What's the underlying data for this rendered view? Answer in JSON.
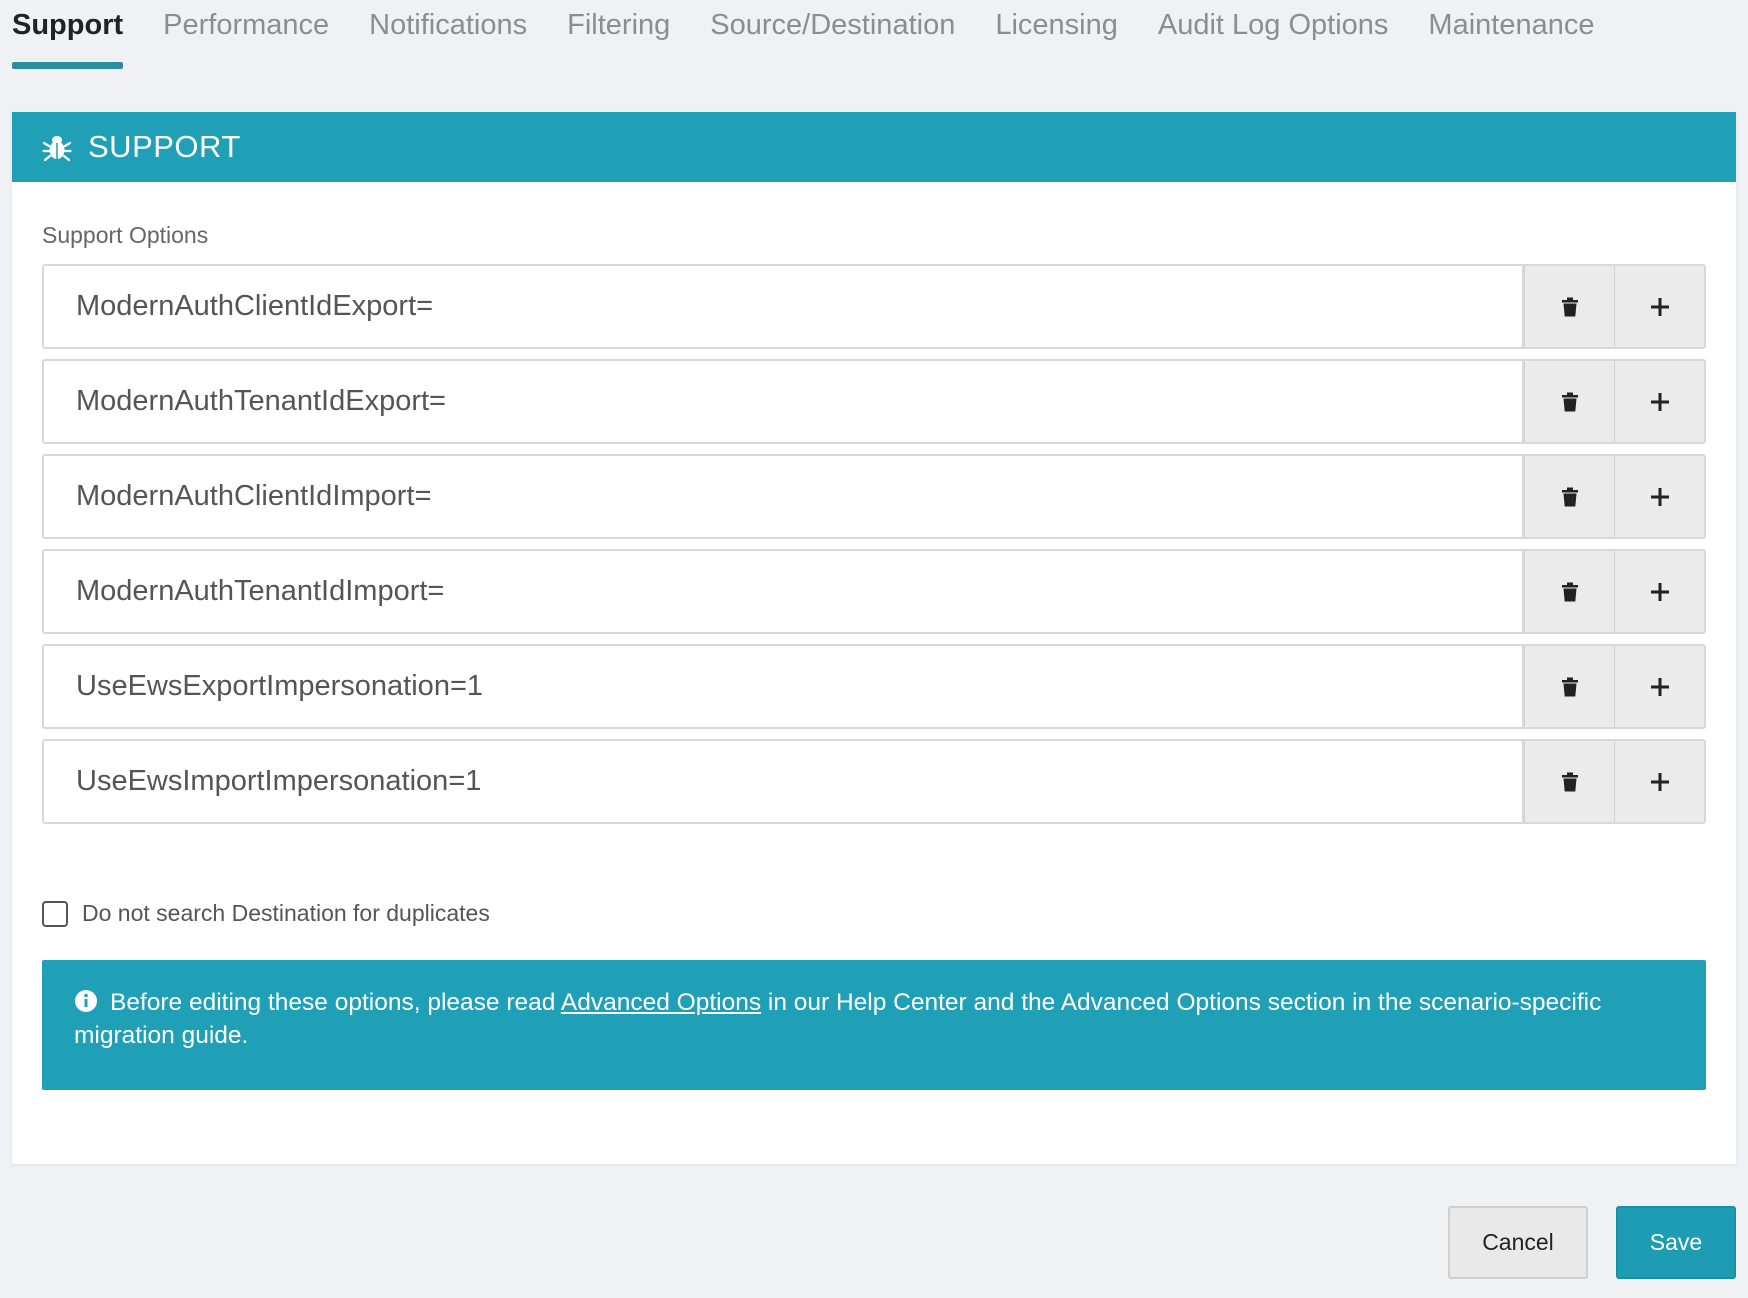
{
  "tabs": [
    {
      "label": "Support",
      "active": true
    },
    {
      "label": "Performance"
    },
    {
      "label": "Notifications"
    },
    {
      "label": "Filtering"
    },
    {
      "label": "Source/Destination"
    },
    {
      "label": "Licensing"
    },
    {
      "label": "Audit Log Options"
    },
    {
      "label": "Maintenance"
    }
  ],
  "card": {
    "title": "SUPPORT",
    "icon": "bug-icon",
    "section_label": "Support Options"
  },
  "options": [
    {
      "value": "ModernAuthClientIdExport="
    },
    {
      "value": "ModernAuthTenantIdExport="
    },
    {
      "value": "ModernAuthClientIdImport="
    },
    {
      "value": "ModernAuthTenantIdImport="
    },
    {
      "value": "UseEwsExportImpersonation=1"
    },
    {
      "value": "UseEwsImportImpersonation=1"
    }
  ],
  "checkbox": {
    "label": "Do not search Destination for duplicates",
    "checked": false
  },
  "info": {
    "prefix": "Before editing these options, please read ",
    "link": "Advanced Options",
    "suffix": " in our Help Center and the Advanced Options section in the scenario-specific migration guide."
  },
  "buttons": {
    "cancel": "Cancel",
    "save": "Save"
  },
  "colors": {
    "accent": "#20a0b7",
    "tab_underline": "#2a8e9e"
  }
}
